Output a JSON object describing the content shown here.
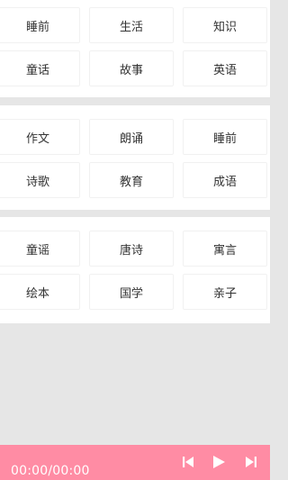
{
  "categories": [
    [
      "睡前",
      "生活",
      "知识",
      "童话",
      "故事",
      "英语"
    ],
    [
      "作文",
      "朗诵",
      "睡前",
      "诗歌",
      "教育",
      "成语"
    ],
    [
      "童谣",
      "唐诗",
      "寓言",
      "绘本",
      "国学",
      "亲子"
    ]
  ],
  "player": {
    "time": "00:00/00:00",
    "accent_color": "#ff8ca4",
    "prev_icon": "skip-previous-icon",
    "play_icon": "play-icon",
    "next_icon": "skip-next-icon"
  }
}
